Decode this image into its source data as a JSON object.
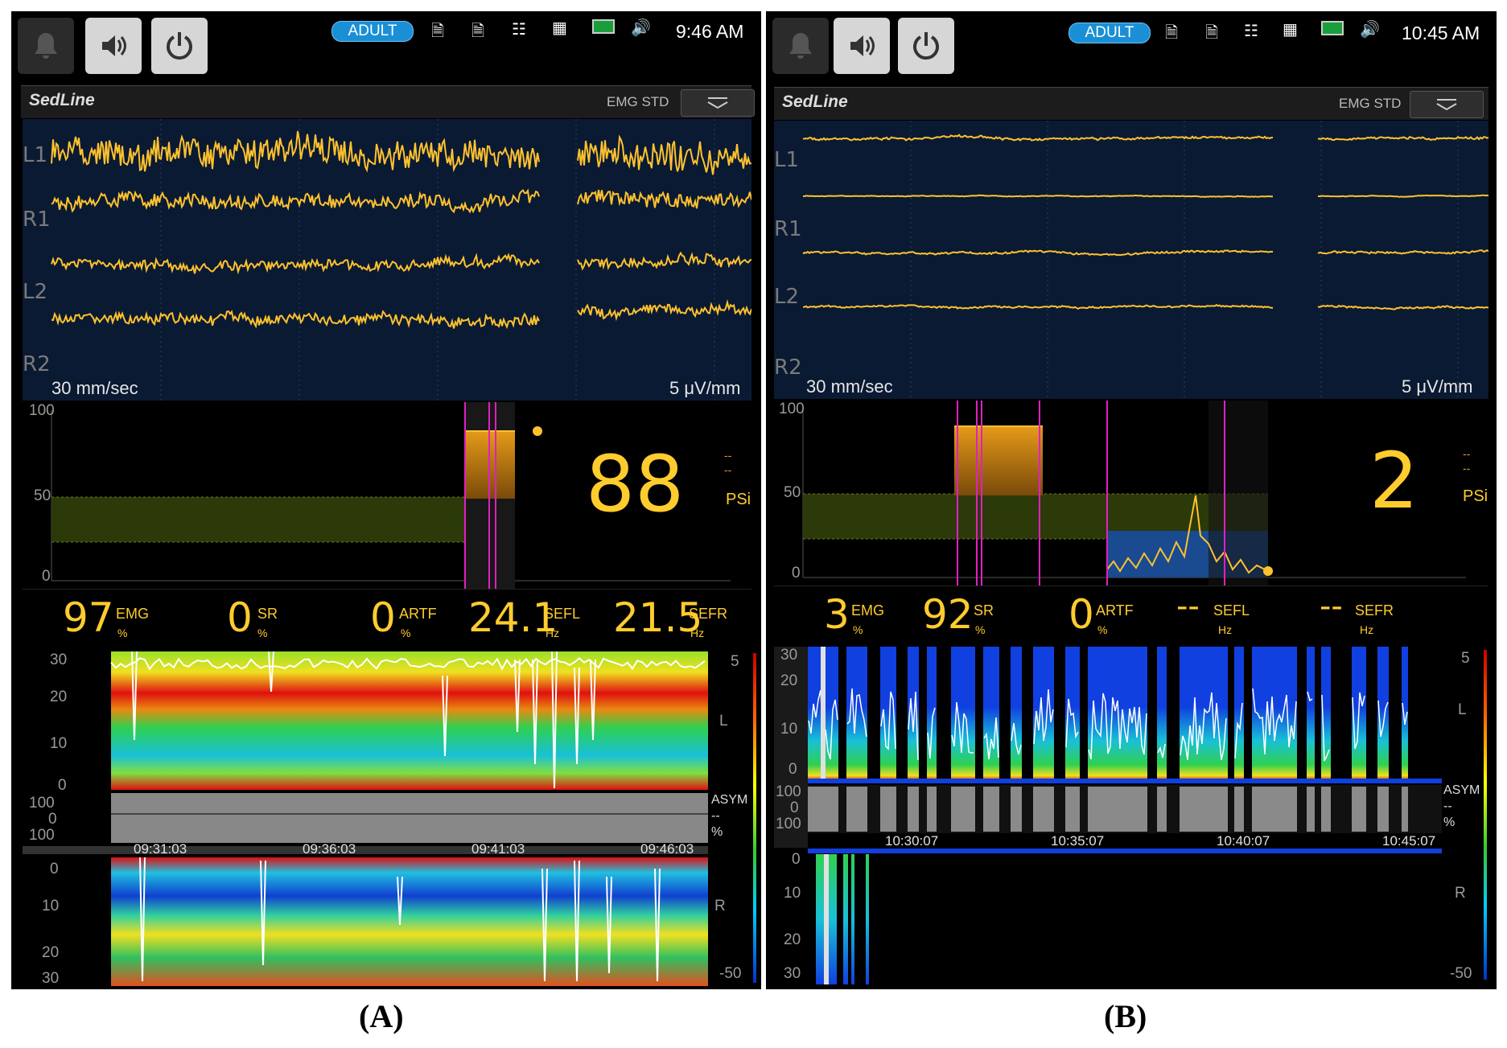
{
  "panelA": {
    "mode_badge": "ADULT",
    "clock": "9:46 AM",
    "brand": "SedLine",
    "emg_mode": "EMG STD",
    "channels": [
      "L1",
      "R1",
      "L2",
      "R2"
    ],
    "sweep_speed": "30 mm/sec",
    "sensitivity": "5 μV/mm",
    "psi_axis": [
      "100",
      "50",
      "0"
    ],
    "psi_value": "88",
    "psi_label": "PSi",
    "psi_dashes": [
      "--",
      "--"
    ],
    "params": [
      {
        "value": "97",
        "label": "EMG",
        "unit": "%"
      },
      {
        "value": "0",
        "label": "SR",
        "unit": "%"
      },
      {
        "value": "0",
        "label": "ARTF",
        "unit": "%"
      },
      {
        "value": "24.1",
        "label": "SEFL",
        "unit": "Hz"
      },
      {
        "value": "21.5",
        "label": "SEFR",
        "unit": "Hz"
      }
    ],
    "dsa_left_axis": [
      "30",
      "20",
      "10",
      "0"
    ],
    "asym_axis": [
      "100",
      "0",
      "100"
    ],
    "asym_label": "ASYM",
    "asym_value": "--",
    "asym_unit": "%",
    "times": [
      "09:31:03",
      "09:36:03",
      "09:41:03",
      "09:46:03"
    ],
    "dsa_right_axis": [
      "0",
      "10",
      "20",
      "30"
    ],
    "scale_top": "5",
    "scale_bottom": "-50",
    "side_L": "L",
    "side_R": "R"
  },
  "panelB": {
    "mode_badge": "ADULT",
    "clock": "10:45 AM",
    "brand": "SedLine",
    "emg_mode": "EMG STD",
    "channels": [
      "L1",
      "R1",
      "L2",
      "R2"
    ],
    "sweep_speed": "30 mm/sec",
    "sensitivity": "5 μV/mm",
    "psi_axis": [
      "100",
      "50",
      "0"
    ],
    "psi_value": "2",
    "psi_label": "PSi",
    "psi_dashes": [
      "--",
      "--"
    ],
    "params": [
      {
        "value": "3",
        "label": "EMG",
        "unit": "%"
      },
      {
        "value": "92",
        "label": "SR",
        "unit": "%"
      },
      {
        "value": "0",
        "label": "ARTF",
        "unit": "%"
      },
      {
        "value": "--",
        "label": "SEFL",
        "unit": "Hz"
      },
      {
        "value": "--",
        "label": "SEFR",
        "unit": "Hz"
      }
    ],
    "dsa_left_axis": [
      "30",
      "20",
      "10",
      "0"
    ],
    "asym_axis": [
      "100",
      "0",
      "100"
    ],
    "asym_label": "ASYM",
    "asym_value": "--",
    "asym_unit": "%",
    "times": [
      "10:30:07",
      "10:35:07",
      "10:40:07",
      "10:45:07"
    ],
    "dsa_right_axis": [
      "0",
      "10",
      "20",
      "30"
    ],
    "scale_top": "5",
    "scale_bottom": "-50",
    "side_L": "L",
    "side_R": "R"
  },
  "captions": {
    "a": "(A)",
    "b": "(B)"
  },
  "colors": {
    "waveform": "#ffc22e",
    "psi_text": "#ffcc2e",
    "marker": "#e020c0",
    "eeg_bg": "#0a1a33"
  },
  "icons": [
    "bell-icon",
    "speaker-icon",
    "power-icon",
    "patient-record-1-icon",
    "patient-record-2-icon",
    "network-icon",
    "grid-icon",
    "battery-icon",
    "volume-icon",
    "dropdown-chevron-icon"
  ]
}
